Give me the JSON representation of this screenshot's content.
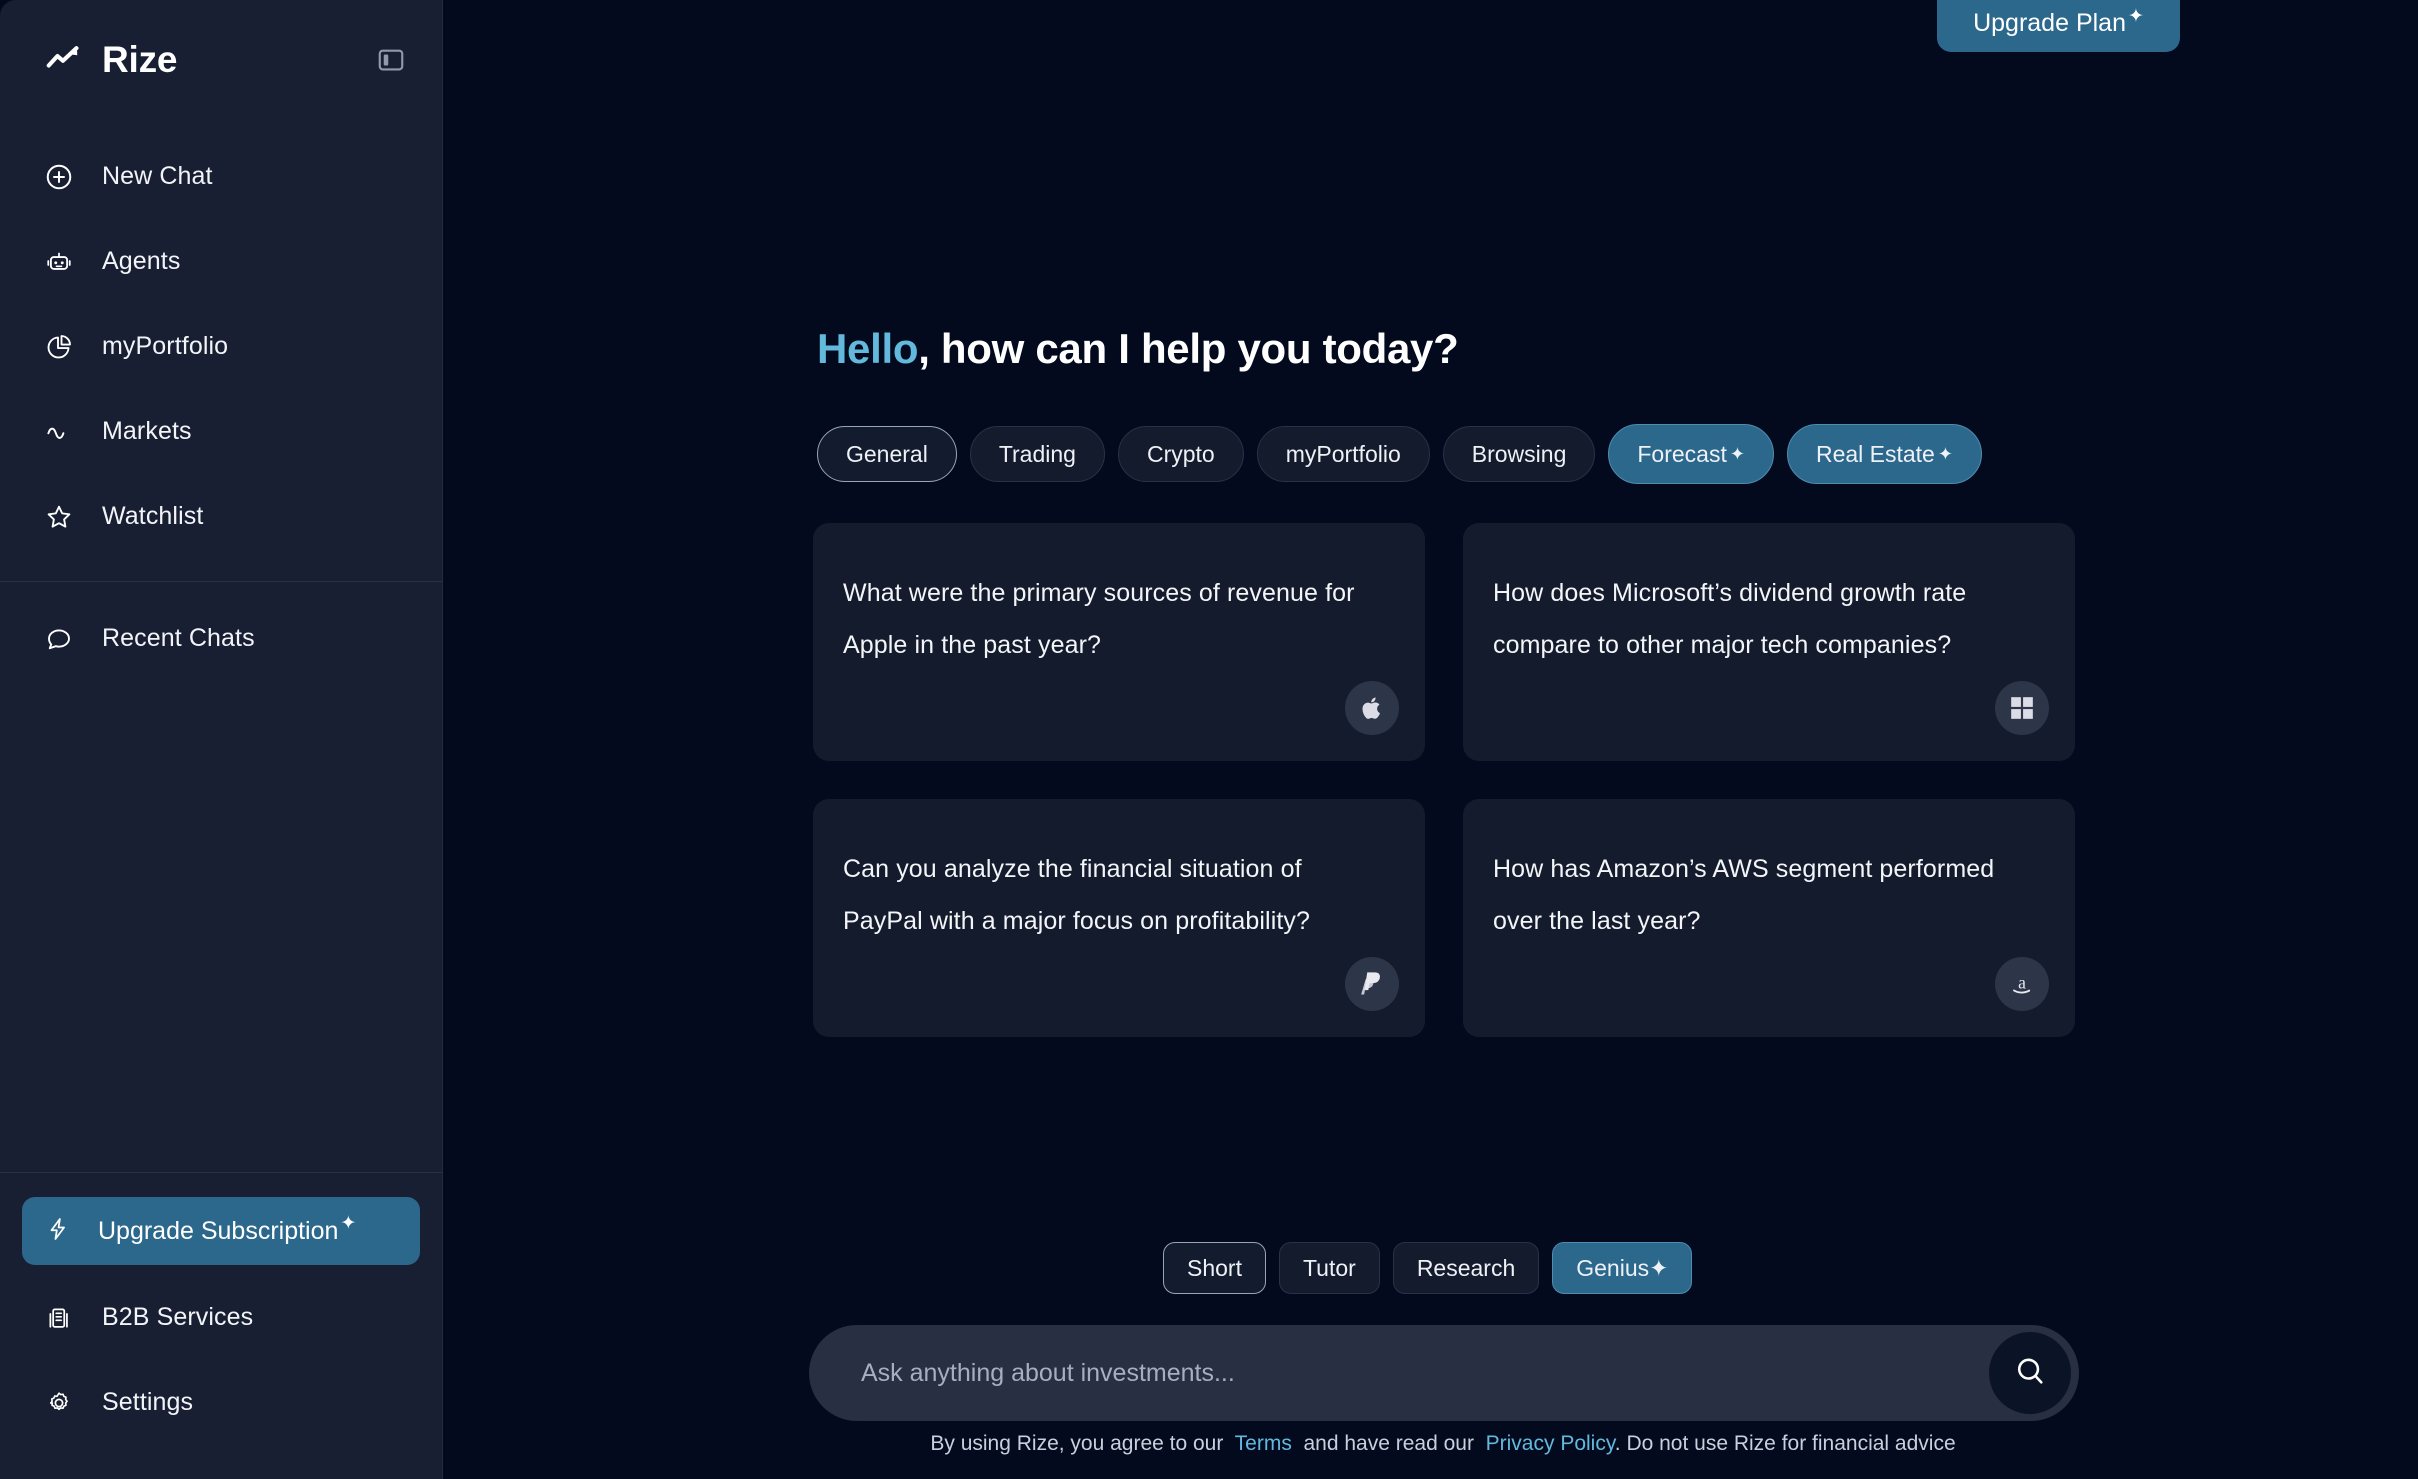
{
  "app": {
    "brand": "Rize"
  },
  "sidebar": {
    "collapse_icon": "panel-collapse-icon",
    "nav": [
      {
        "label": "New Chat",
        "icon": "plus-circle-icon"
      },
      {
        "label": "Agents",
        "icon": "robot-icon"
      },
      {
        "label": "myPortfolio",
        "icon": "pie-chart-icon"
      },
      {
        "label": "Markets",
        "icon": "wave-icon"
      },
      {
        "label": "Watchlist",
        "icon": "star-icon"
      }
    ],
    "recent": {
      "label": "Recent Chats",
      "icon": "chat-bubble-icon"
    },
    "footer": [
      {
        "label": "Upgrade Subscription",
        "icon": "lightning-icon",
        "pro": true,
        "star": "✦"
      },
      {
        "label": "B2B Services",
        "icon": "building-icon",
        "pro": false
      },
      {
        "label": "Settings",
        "icon": "gear-icon",
        "pro": false
      }
    ]
  },
  "header": {
    "upgrade_plan_label": "Upgrade Plan",
    "upgrade_plan_star": "✦"
  },
  "main": {
    "greeting_highlight": "Hello",
    "greeting_rest": ", how can I help you today?",
    "categories": [
      {
        "label": "General",
        "selected": true,
        "pro": false
      },
      {
        "label": "Trading",
        "selected": false,
        "pro": false
      },
      {
        "label": "Crypto",
        "selected": false,
        "pro": false
      },
      {
        "label": "myPortfolio",
        "selected": false,
        "pro": false
      },
      {
        "label": "Browsing",
        "selected": false,
        "pro": false
      },
      {
        "label": "Forecast",
        "selected": false,
        "pro": true,
        "star": "✦"
      },
      {
        "label": "Real Estate",
        "selected": false,
        "pro": true,
        "star": "✦"
      }
    ],
    "suggestions": [
      {
        "text": "What were the primary sources of revenue for Apple in the past year?",
        "logo": "apple-logo-icon"
      },
      {
        "text": "How does Microsoft’s dividend growth rate compare to other major tech companies?",
        "logo": "microsoft-logo-icon"
      },
      {
        "text": "Can you analyze the financial situation of PayPal with a major focus on profitability?",
        "logo": "paypal-logo-icon"
      },
      {
        "text": "How has Amazon’s AWS segment performed over the last year?",
        "logo": "amazon-logo-icon"
      }
    ],
    "modes": [
      {
        "label": "Short",
        "selected": true,
        "pro": false
      },
      {
        "label": "Tutor",
        "selected": false,
        "pro": false
      },
      {
        "label": "Research",
        "selected": false,
        "pro": false
      },
      {
        "label": "Genius",
        "selected": false,
        "pro": true,
        "star": "✦"
      }
    ],
    "search": {
      "placeholder": "Ask anything about investments...",
      "value": "",
      "submit_icon": "search-icon"
    },
    "footer": {
      "part1": "By using Rize, you agree to our",
      "terms": "Terms",
      "part2": "and have read our",
      "privacy": "Privacy Policy",
      "part3": ". Do not use Rize for financial advice"
    }
  },
  "colors": {
    "background": "#030A1E",
    "sidebar": "#181F33",
    "card": "#141B2C",
    "accent": "#2C678C",
    "highlight": "#62B9DC",
    "input": "#292F42"
  }
}
